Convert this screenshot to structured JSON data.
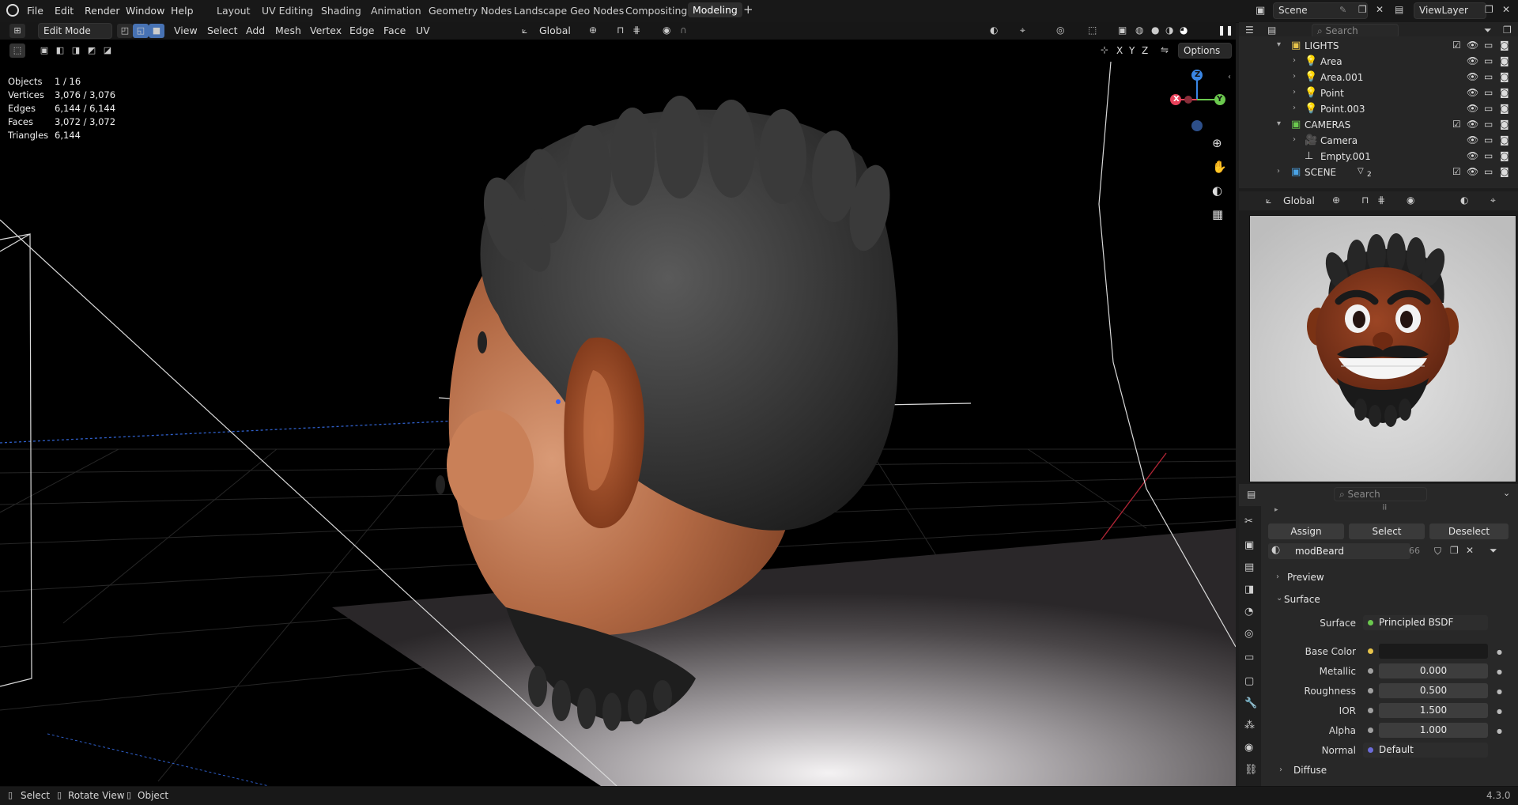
{
  "topbar": {
    "menu": [
      "File",
      "Edit",
      "Render",
      "Window",
      "Help"
    ],
    "workspaces": [
      "Layout",
      "UV Editing",
      "Shading",
      "Animation",
      "Geometry Nodes",
      "Landscape Geo Nodes",
      "Compositing",
      "Modeling"
    ],
    "active_workspace": "Modeling",
    "add_tab": "+",
    "scene": "Scene",
    "view_layer": "ViewLayer"
  },
  "viewport_header": {
    "mode": "Edit Mode",
    "menus": [
      "View",
      "Select",
      "Add",
      "Mesh",
      "Vertex",
      "Edge",
      "Face",
      "UV"
    ],
    "orientation": "Global",
    "options": "Options",
    "axes": [
      "X",
      "Y",
      "Z"
    ]
  },
  "stats": {
    "objects_label": "Objects",
    "objects": "1 / 16",
    "vertices_label": "Vertices",
    "vertices": "3,076 / 3,076",
    "edges_label": "Edges",
    "edges": "6,144 / 6,144",
    "faces_label": "Faces",
    "faces": "3,072 / 3,072",
    "triangles_label": "Triangles",
    "triangles": "6,144"
  },
  "gizmo": {
    "x": "X",
    "y": "Y",
    "z": "Z"
  },
  "outliner": {
    "search_placeholder": "Search",
    "rows": [
      {
        "label": "LIGHTS",
        "type": "collection"
      },
      {
        "label": "Area",
        "type": "light"
      },
      {
        "label": "Area.001",
        "type": "light"
      },
      {
        "label": "Point",
        "type": "light"
      },
      {
        "label": "Point.003",
        "type": "light"
      },
      {
        "label": "CAMERAS",
        "type": "collection"
      },
      {
        "label": "Camera",
        "type": "camera"
      },
      {
        "label": "Empty.001",
        "type": "empty"
      },
      {
        "label": "SCENE",
        "type": "collection",
        "badge": "2"
      }
    ]
  },
  "preview_header": {
    "orientation": "Global"
  },
  "properties": {
    "search_placeholder": "Search",
    "assign": "Assign",
    "select": "Select",
    "deselect": "Deselect",
    "material_name": "modBeard",
    "material_users": "66",
    "preview": "Preview",
    "surface_panel": "Surface",
    "surface_label": "Surface",
    "surface_value": "Principled BSDF",
    "base_color_label": "Base Color",
    "metallic_label": "Metallic",
    "metallic": "0.000",
    "roughness_label": "Roughness",
    "roughness": "0.500",
    "ior_label": "IOR",
    "ior": "1.500",
    "alpha_label": "Alpha",
    "alpha": "1.000",
    "normal_label": "Normal",
    "normal_value": "Default",
    "diffuse": "Diffuse"
  },
  "statusbar": {
    "select": "Select",
    "rotate": "Rotate View",
    "object": "Object",
    "version": "4.3.0"
  },
  "colors": {
    "accent_blue": "#4772b3",
    "x_axis": "#e8415a",
    "y_axis": "#6bc94e",
    "z_axis": "#3a86e4",
    "skin": "#b0603a",
    "hair": "#2a2a2a"
  }
}
